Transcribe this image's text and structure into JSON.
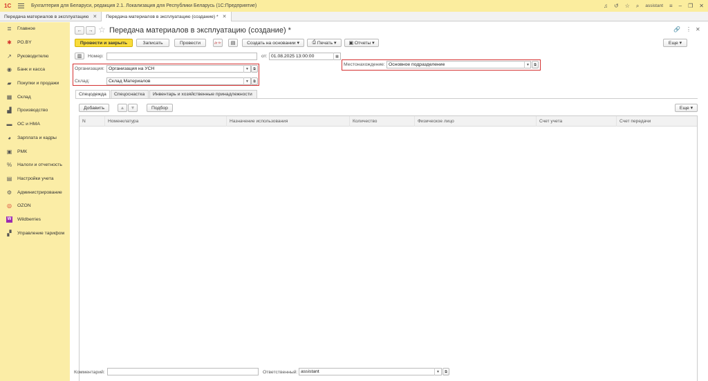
{
  "app": {
    "title": "Бухгалтерия для Беларуси, редакция 2.1. Локализация для Республики Беларусь   (1С:Предприятие)",
    "logo": "1С",
    "user": "assistant"
  },
  "tabs": [
    {
      "label": "Передача материалов в эксплуатацию"
    },
    {
      "label": "Передача материалов в эксплуатацию (создание) *"
    }
  ],
  "sidebar": {
    "items": [
      {
        "label": "Главное",
        "icon": "≣"
      },
      {
        "label": "РО.BY",
        "icon": "✱"
      },
      {
        "label": "Руководителю",
        "icon": "↗"
      },
      {
        "label": "Банк и касса",
        "icon": "◉"
      },
      {
        "label": "Покупки и продажи",
        "icon": "▰"
      },
      {
        "label": "Склад",
        "icon": "▦"
      },
      {
        "label": "Производство",
        "icon": "▟"
      },
      {
        "label": "ОС и НМА",
        "icon": "▬"
      },
      {
        "label": "Зарплата и кадры",
        "icon": "◕"
      },
      {
        "label": "РМК",
        "icon": "▣"
      },
      {
        "label": "Налоги и отчетность",
        "icon": "%"
      },
      {
        "label": "Настройки учета",
        "icon": "▤"
      },
      {
        "label": "Администрирование",
        "icon": "⚙"
      },
      {
        "label": "OZON",
        "icon": "◎"
      },
      {
        "label": "Wildberries",
        "icon": "W"
      },
      {
        "label": "Управление тарифом",
        "icon": "▞"
      }
    ]
  },
  "document": {
    "title": "Передача материалов в эксплуатацию (создание) *",
    "more_label": "Еще",
    "toolbar": {
      "post_close": "Провести и закрыть",
      "save": "Записать",
      "post": "Провести",
      "create_based": "Создать на основании",
      "print": "Печать",
      "reports": "Отчеты",
      "dt_kt": "Дт Кт"
    },
    "number_label": "Номер:",
    "number_value": "",
    "date_label": "от:",
    "date_value": "01.08.2025 13:00:00",
    "org_label": "Организация:",
    "org_value": "Организация на УСН",
    "warehouse_label": "Склад:",
    "warehouse_value": "Склад Материалов",
    "location_label": "Местонахождение:",
    "location_value": "Основное подразделение",
    "form_tabs": [
      {
        "label": "Спецодежда"
      },
      {
        "label": "Спецоснастка"
      },
      {
        "label": "Инвентарь и хозяйственные принадлежности"
      }
    ],
    "table_toolbar": {
      "add": "Добавить",
      "selection": "Подбор",
      "more": "Еще"
    },
    "columns": [
      "N",
      "Номенклатура",
      "Назначение использования",
      "Количество",
      "Физическое лицо",
      "Счет учета",
      "Счет передачи"
    ],
    "comment_label": "Комментарий:",
    "comment_value": "",
    "responsible_label": "Ответственный:",
    "responsible_value": "assistant"
  },
  "colors": {
    "sidebar_bg": "#fbeda6",
    "titlebar_bg": "#fbed9e",
    "primary_button": "#f9dc3c",
    "highlight_border": "#d43030"
  }
}
